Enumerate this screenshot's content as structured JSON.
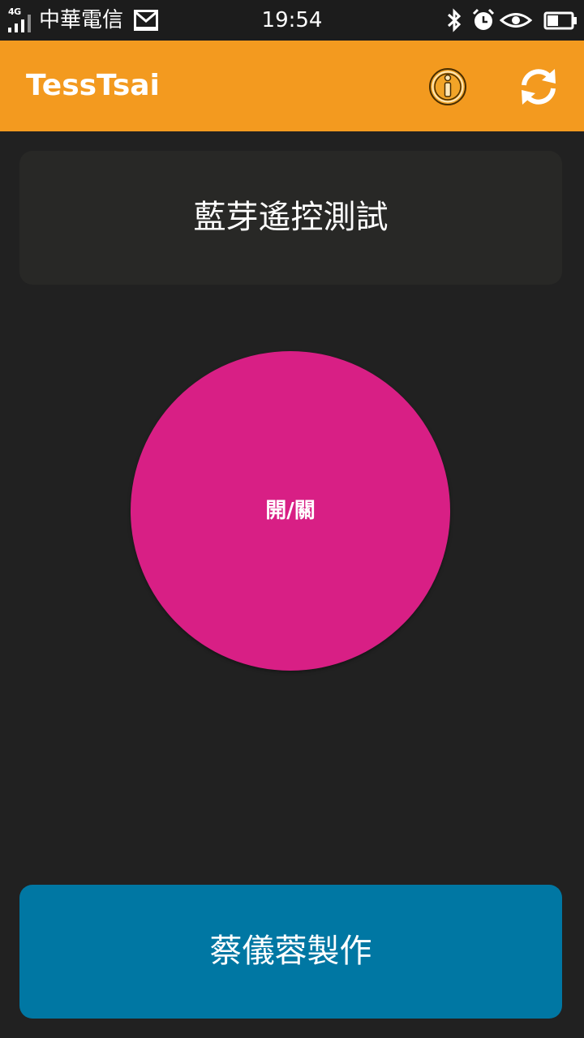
{
  "status_bar": {
    "network_type": "4G",
    "carrier": "中華電信",
    "time": "19:54",
    "icons": [
      "signal-icon",
      "mail-icon",
      "bluetooth-icon",
      "alarm-icon",
      "eye-icon",
      "battery-icon"
    ]
  },
  "app_bar": {
    "title": "TessTsai",
    "actions": [
      "info-icon",
      "refresh-icon"
    ],
    "background": "#f39a1f"
  },
  "main": {
    "heading": "藍芽遙控測試",
    "power_button_label": "開/關",
    "power_button_color": "#d81f85"
  },
  "footer": {
    "credit": "蔡儀蓉製作",
    "background": "#0077a3"
  }
}
